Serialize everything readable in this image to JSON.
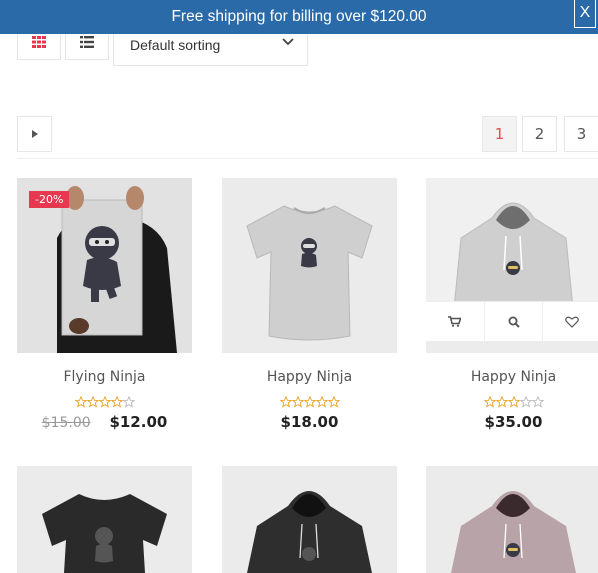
{
  "banner": {
    "text": "Free shipping for billing over $120.00",
    "close_label": "X"
  },
  "toolbar": {
    "grid_view_icon": "grid-icon",
    "list_view_icon": "list-icon",
    "sort_value": "Default sorting"
  },
  "pagination": {
    "pages": [
      "1",
      "2",
      "3"
    ],
    "current": "1"
  },
  "products": [
    {
      "name": "Flying Ninja",
      "badge": "-20%",
      "old_price": "$15.00",
      "price": "$12.00",
      "rating": 4
    },
    {
      "name": "Happy Ninja",
      "price": "$18.00",
      "rating": 5
    },
    {
      "name": "Happy Ninja",
      "price": "$35.00",
      "rating": 3
    }
  ],
  "colors": {
    "banner": "#2a6aa8",
    "sale": "#e8384f",
    "active_page": "#e34b55",
    "star": "#e8a326"
  }
}
